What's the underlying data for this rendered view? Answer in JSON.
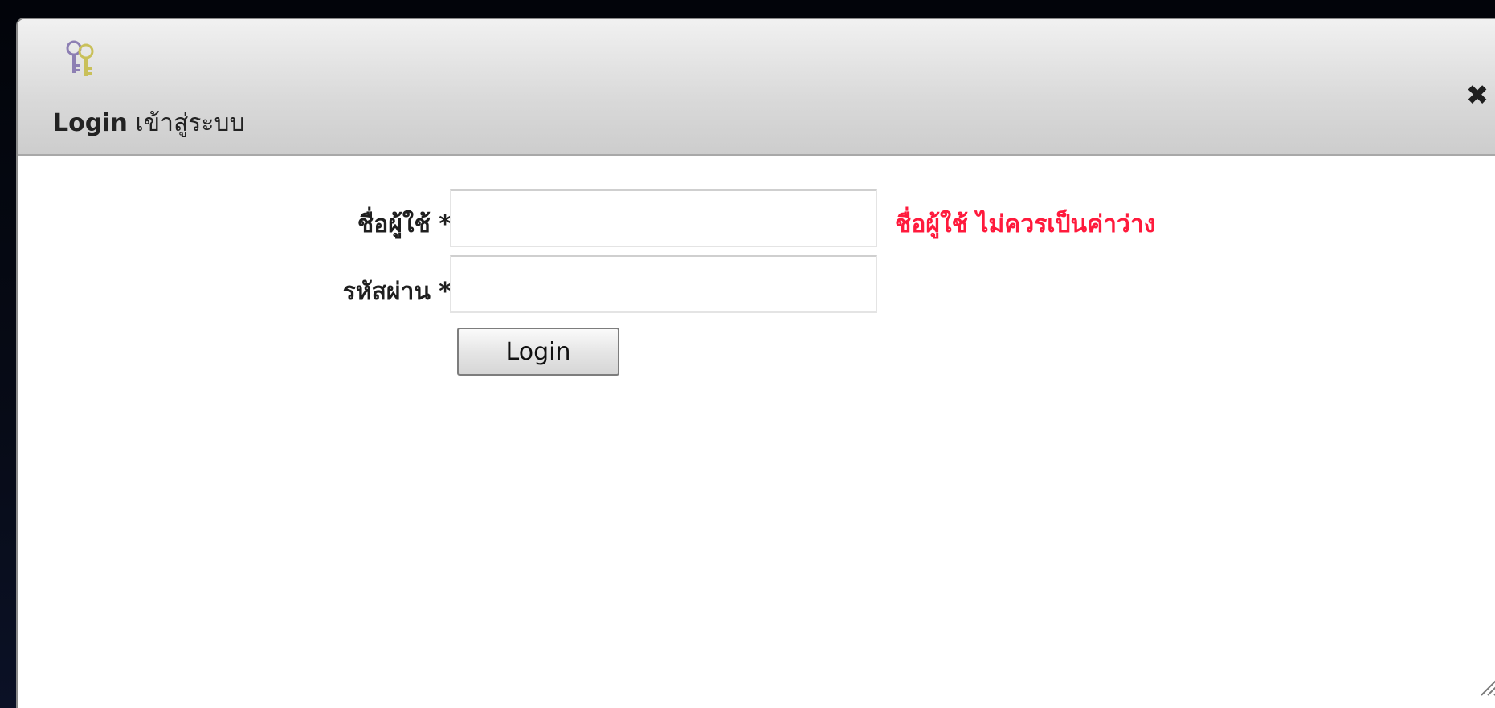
{
  "dialog": {
    "title_bold": "Login",
    "title_rest": " เข้าสู่ระบบ",
    "icon": "keys-icon",
    "close_icon": "close-icon",
    "close_glyph": "✖"
  },
  "form": {
    "username_label": "ชื่อผู้ใช้ *",
    "password_label": "รหัสผ่าน *",
    "username_value": "",
    "password_value": "",
    "username_error": "ชื่อผู้ใช้ ไม่ควรเป็นค่าว่าง",
    "login_label": "Login"
  },
  "colors": {
    "error": "#ff1a3c",
    "titlebar": "#d9d9d9",
    "background": "#05070f"
  }
}
